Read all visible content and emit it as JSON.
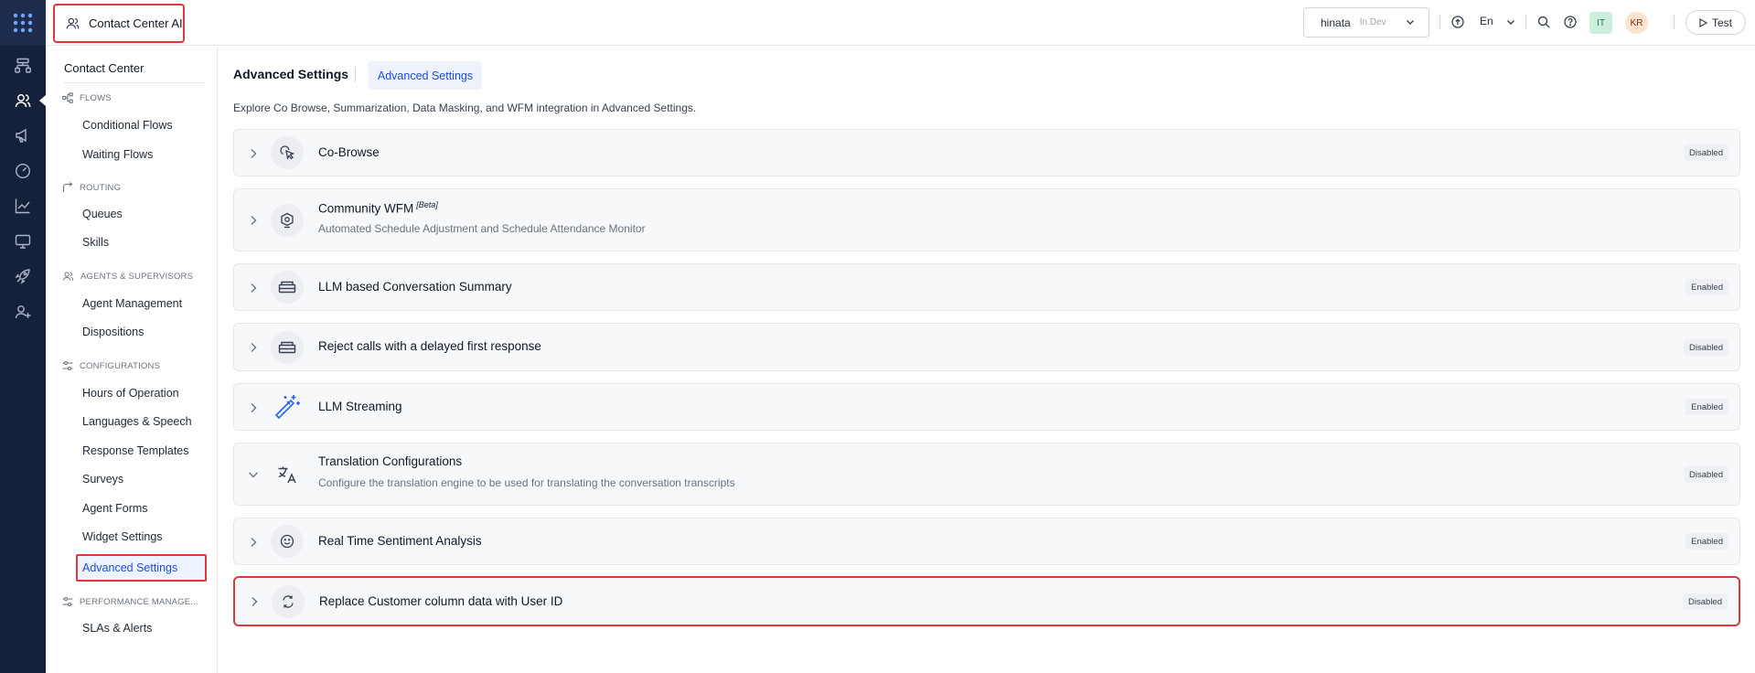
{
  "header": {
    "app_title": "Contact Center AI",
    "bot_name": "hinata",
    "bot_env": "In Dev",
    "language": "En",
    "avatar_it": "IT",
    "avatar_kr": "KR",
    "test_label": "Test"
  },
  "sidebar": {
    "title": "Contact Center",
    "sections": [
      {
        "label": "FLOWS",
        "items": [
          "Conditional Flows",
          "Waiting Flows"
        ]
      },
      {
        "label": "ROUTING",
        "items": [
          "Queues",
          "Skills"
        ]
      },
      {
        "label": "AGENTS & SUPERVISORS",
        "items": [
          "Agent Management",
          "Dispositions"
        ]
      },
      {
        "label": "CONFIGURATIONS",
        "items": [
          "Hours of Operation",
          "Languages & Speech",
          "Response Templates",
          "Surveys",
          "Agent Forms",
          "Widget Settings",
          "Advanced Settings"
        ]
      },
      {
        "label": "PERFORMANCE MANAGE...",
        "items": [
          "SLAs & Alerts"
        ]
      }
    ],
    "active_item": "Advanced Settings"
  },
  "main": {
    "page_title": "Advanced Settings",
    "tab_label": "Advanced Settings",
    "description": "Explore Co Browse, Summarization, Data Masking, and WFM integration in Advanced Settings.",
    "cards": [
      {
        "title": "Co-Browse",
        "subtitle": "",
        "status": "Disabled",
        "icon": "cursor-click-icon",
        "expanded": false
      },
      {
        "title": "Community WFM",
        "title_sup": "[Beta]",
        "subtitle": "Automated Schedule Adjustment and Schedule Attendance Monitor",
        "status": "",
        "icon": "gear-shield-icon",
        "expanded": false
      },
      {
        "title": "LLM based Conversation Summary",
        "subtitle": "",
        "status": "Enabled",
        "icon": "summary-tray-icon",
        "expanded": false
      },
      {
        "title": "Reject calls with a delayed first response",
        "subtitle": "",
        "status": "Disabled",
        "icon": "tray-icon",
        "expanded": false
      },
      {
        "title": "LLM Streaming",
        "subtitle": "",
        "status": "Enabled",
        "icon": "magic-wand-icon",
        "expanded": false
      },
      {
        "title": "Translation Configurations",
        "subtitle": "Configure the translation engine to be used for translating the conversation transcripts",
        "status": "Disabled",
        "icon": "translate-icon",
        "expanded": true
      },
      {
        "title": "Real Time Sentiment Analysis",
        "subtitle": "",
        "status": "Enabled",
        "icon": "smiley-icon",
        "expanded": false
      },
      {
        "title": "Replace Customer column data with User ID",
        "subtitle": "",
        "status": "Disabled",
        "icon": "refresh-icon",
        "expanded": false
      }
    ]
  },
  "colors": {
    "rail_bg": "#15203a",
    "accent": "#1d4ed8",
    "highlight": "#e0373b",
    "card_bg": "#f7f8fa"
  }
}
